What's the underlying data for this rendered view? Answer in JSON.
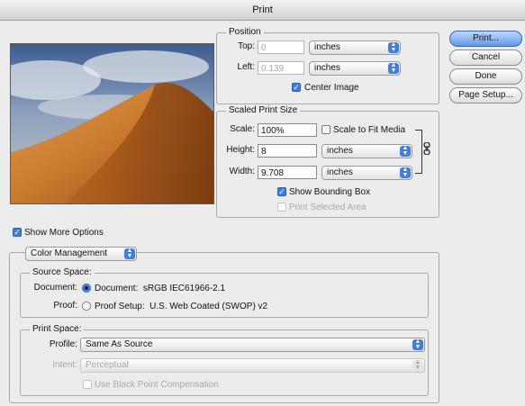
{
  "window": {
    "title": "Print"
  },
  "buttons": {
    "print": "Print...",
    "cancel": "Cancel",
    "done": "Done",
    "page_setup": "Page Setup..."
  },
  "position": {
    "title": "Position",
    "top_label": "Top:",
    "top_value": "0",
    "top_unit": "inches",
    "left_label": "Left:",
    "left_value": "0.139",
    "left_unit": "inches",
    "center_image_label": "Center Image",
    "center_image_checked": true
  },
  "scaled": {
    "title": "Scaled Print Size",
    "scale_label": "Scale:",
    "scale_value": "100%",
    "scale_to_fit_label": "Scale to Fit Media",
    "scale_to_fit_checked": false,
    "height_label": "Height:",
    "height_value": "8",
    "height_unit": "inches",
    "width_label": "Width:",
    "width_value": "9.708",
    "width_unit": "inches",
    "show_bounding_box_label": "Show Bounding Box",
    "show_bounding_box_checked": true,
    "print_selected_area_label": "Print Selected Area",
    "print_selected_area_checked": false
  },
  "more_options": {
    "label": "Show More Options",
    "checked": true
  },
  "color_management": {
    "dropdown": "Color Management",
    "source_space": {
      "title": "Source Space:",
      "document_label": "Document:",
      "document_option": "Document:  sRGB IEC61966-2.1",
      "proof_label": "Proof:",
      "proof_option": "Proof Setup:  U.S. Web Coated (SWOP) v2",
      "selected": "document"
    },
    "print_space": {
      "title": "Print Space:",
      "profile_label": "Profile:",
      "profile_value": "Same As Source",
      "intent_label": "Intent:",
      "intent_value": "Perceptual",
      "black_point_label": "Use Black Point Compensation"
    }
  },
  "icons": [
    "link-icon",
    "check-icon",
    "popup-arrows-icon"
  ],
  "colors": {
    "accent": "#3d7fe0",
    "window_bg": "#ececec"
  }
}
